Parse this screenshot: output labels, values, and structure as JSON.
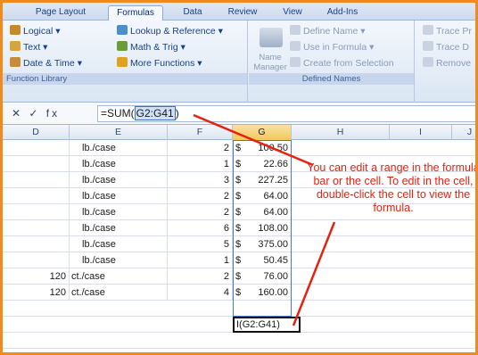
{
  "ribbon": {
    "tabs": [
      {
        "label": "Page Layout"
      },
      {
        "label": "Formulas",
        "active": true
      },
      {
        "label": "Data"
      },
      {
        "label": "Review"
      },
      {
        "label": "View"
      },
      {
        "label": "Add-Ins"
      }
    ],
    "function_library": {
      "group_label": "Function Library",
      "logical": "Logical ▾",
      "text": "Text ▾",
      "date_time": "Date & Time ▾",
      "lookup_reference": "Lookup & Reference ▾",
      "math_trig": "Math & Trig ▾",
      "more_functions": "More Functions ▾"
    },
    "defined_names": {
      "group_label": "Defined Names",
      "name_manager": "Name\nManager",
      "define_name": "Define Name ▾",
      "use_in_formula": "Use in Formula ▾",
      "create_from_selection": "Create from Selection"
    },
    "formula_auditing": {
      "trace_precedents": "Trace Pr",
      "trace_dependents": "Trace D",
      "remove_arrows": "Remove"
    }
  },
  "formula_bar": {
    "controls": "✕ ✓ fx",
    "formula_prefix": "=SUM(",
    "formula_range": "G2:G41",
    "formula_suffix": ")"
  },
  "columns": [
    "D",
    "E",
    "F",
    "G",
    "H",
    "I",
    "J"
  ],
  "rows": [
    {
      "d": "",
      "e": "lb./case",
      "f": "2",
      "g_sym": "$",
      "g": "100.50"
    },
    {
      "d": "",
      "e": "lb./case",
      "f": "1",
      "g_sym": "$",
      "g": "22.66"
    },
    {
      "d": "",
      "e": "lb./case",
      "f": "3",
      "g_sym": "$",
      "g": "227.25"
    },
    {
      "d": "",
      "e": "lb./case",
      "f": "2",
      "g_sym": "$",
      "g": "64.00"
    },
    {
      "d": "",
      "e": "lb./case",
      "f": "2",
      "g_sym": "$",
      "g": "64.00"
    },
    {
      "d": "",
      "e": "lb./case",
      "f": "6",
      "g_sym": "$",
      "g": "108.00"
    },
    {
      "d": "",
      "e": "lb./case",
      "f": "5",
      "g_sym": "$",
      "g": "375.00"
    },
    {
      "d": "",
      "e": "lb./case",
      "f": "1",
      "g_sym": "$",
      "g": "50.45"
    },
    {
      "d": "120",
      "e": "ct./case",
      "f": "2",
      "g_sym": "$",
      "g": "76.00"
    },
    {
      "d": "120",
      "e": "ct./case",
      "f": "4",
      "g_sym": "$",
      "g": "160.00"
    }
  ],
  "editing_cell": "I(G2:G41)",
  "annotation": "You can edit a range in the formula bar or the cell. To edit in the cell, double-click the cell to view the formula.",
  "colors": {
    "frame": "#f08a1c",
    "annotation": "#e8210f",
    "range_border": "#4a78c8"
  }
}
